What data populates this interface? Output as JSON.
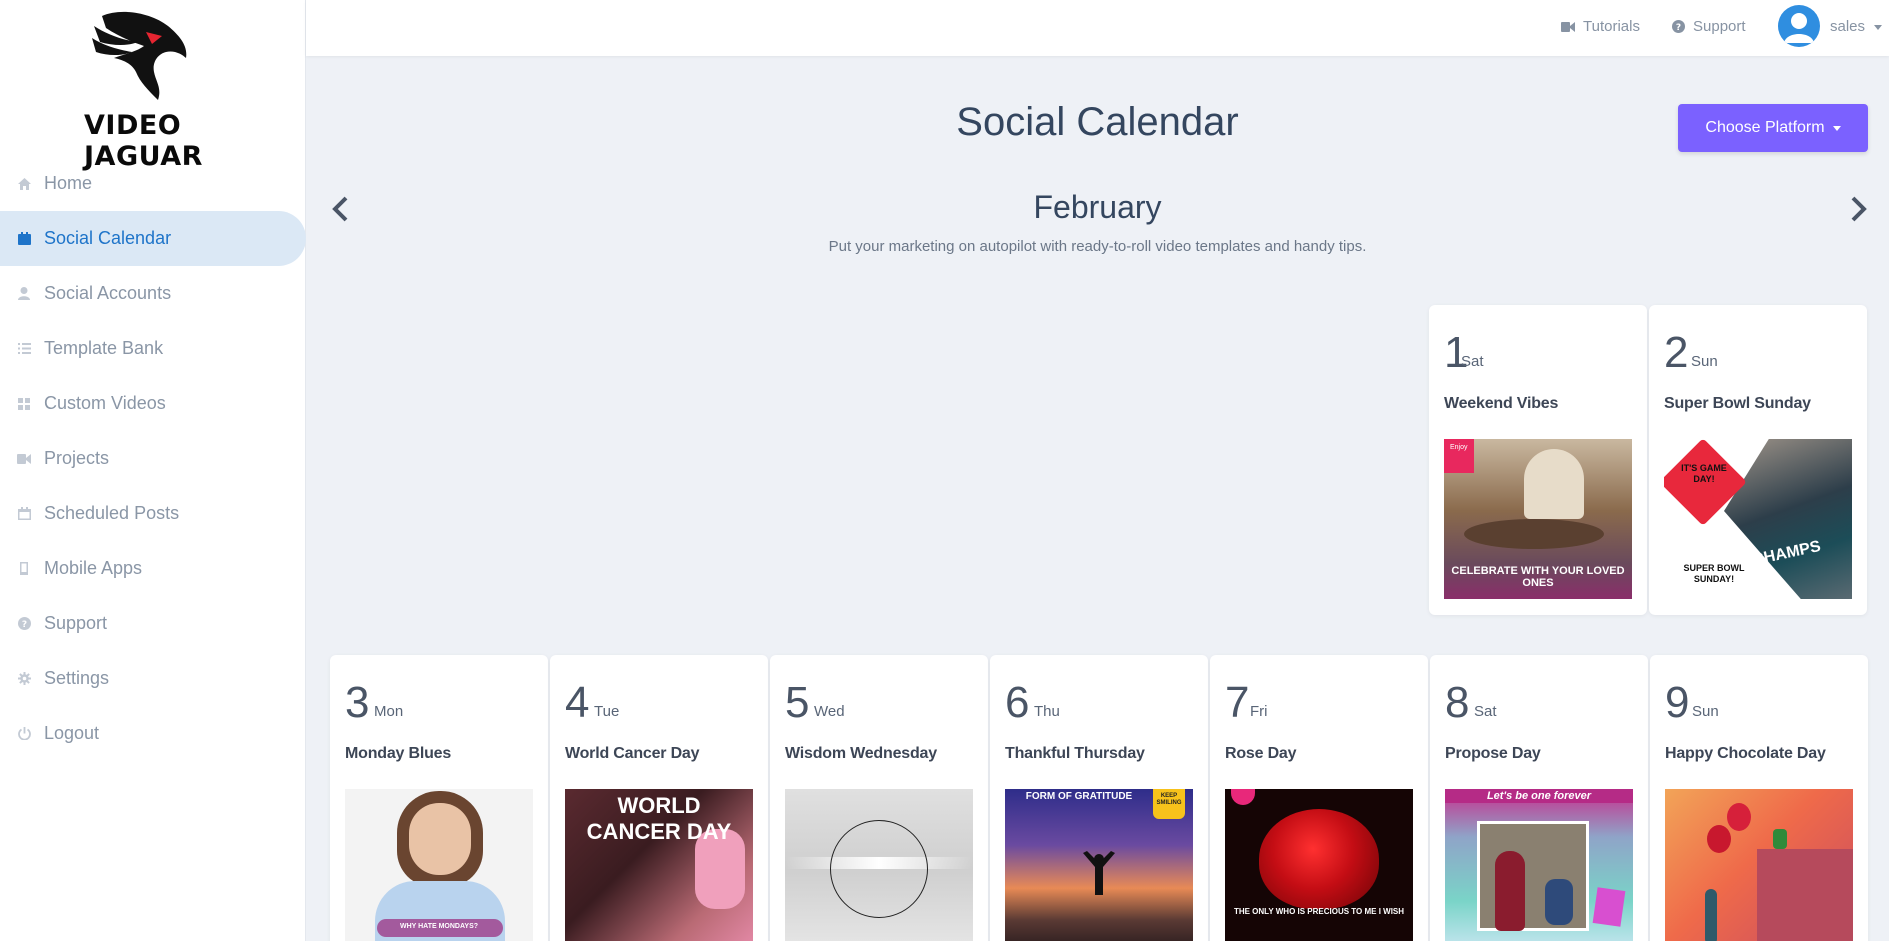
{
  "brand": {
    "name": "VIDEO JAGUAR",
    "accent": "#7b61ff",
    "active_color": "#1e74c9"
  },
  "sidebar": {
    "items": [
      {
        "label": "Home",
        "icon": "home-icon",
        "active": false
      },
      {
        "label": "Social Calendar",
        "icon": "calendar-icon",
        "active": true
      },
      {
        "label": "Social Accounts",
        "icon": "user-icon",
        "active": false
      },
      {
        "label": "Template Bank",
        "icon": "list-icon",
        "active": false
      },
      {
        "label": "Custom Videos",
        "icon": "grid-icon",
        "active": false
      },
      {
        "label": "Projects",
        "icon": "video-camera-icon",
        "active": false
      },
      {
        "label": "Scheduled Posts",
        "icon": "calendar-outline-icon",
        "active": false
      },
      {
        "label": "Mobile Apps",
        "icon": "mobile-icon",
        "active": false
      },
      {
        "label": "Support",
        "icon": "question-circle-icon",
        "active": false
      },
      {
        "label": "Settings",
        "icon": "gear-icon",
        "active": false
      },
      {
        "label": "Logout",
        "icon": "power-icon",
        "active": false
      }
    ]
  },
  "topbar": {
    "tutorials": "Tutorials",
    "support": "Support",
    "user": "sales"
  },
  "main": {
    "title": "Social Calendar",
    "choose_platform": "Choose Platform",
    "month": "February",
    "tagline": "Put your marketing on autopilot with ready-to-roll video templates and handy tips."
  },
  "days": [
    {
      "num": "1",
      "dow": "Sat",
      "event": "Weekend Vibes",
      "thumb_text": "CELEBRATE WITH YOUR LOVED ONES",
      "badge": "Enjoy"
    },
    {
      "num": "2",
      "dow": "Sun",
      "event": "Super Bowl Sunday",
      "thumb_text": "IT'S GAME DAY!",
      "thumb_text2": "SUPER BOWL SUNDAY!",
      "thumb_text3": "CHAMPS"
    },
    {
      "num": "3",
      "dow": "Mon",
      "event": "Monday Blues",
      "thumb_text": "WHY HATE MONDAYS?"
    },
    {
      "num": "4",
      "dow": "Tue",
      "event": "World Cancer Day",
      "thumb_text": "WORLD CANCER DAY"
    },
    {
      "num": "5",
      "dow": "Wed",
      "event": "Wisdom Wednesday"
    },
    {
      "num": "6",
      "dow": "Thu",
      "event": "Thankful Thursday",
      "thumb_text": "FORM OF GRATITUDE",
      "badge": "KEEP SMILING"
    },
    {
      "num": "7",
      "dow": "Fri",
      "event": "Rose Day",
      "thumb_text": "THE ONLY WHO IS PRECIOUS TO ME I WISH"
    },
    {
      "num": "8",
      "dow": "Sat",
      "event": "Propose Day",
      "thumb_text": "Let's be one forever"
    },
    {
      "num": "9",
      "dow": "Sun",
      "event": "Happy Chocolate Day"
    }
  ]
}
